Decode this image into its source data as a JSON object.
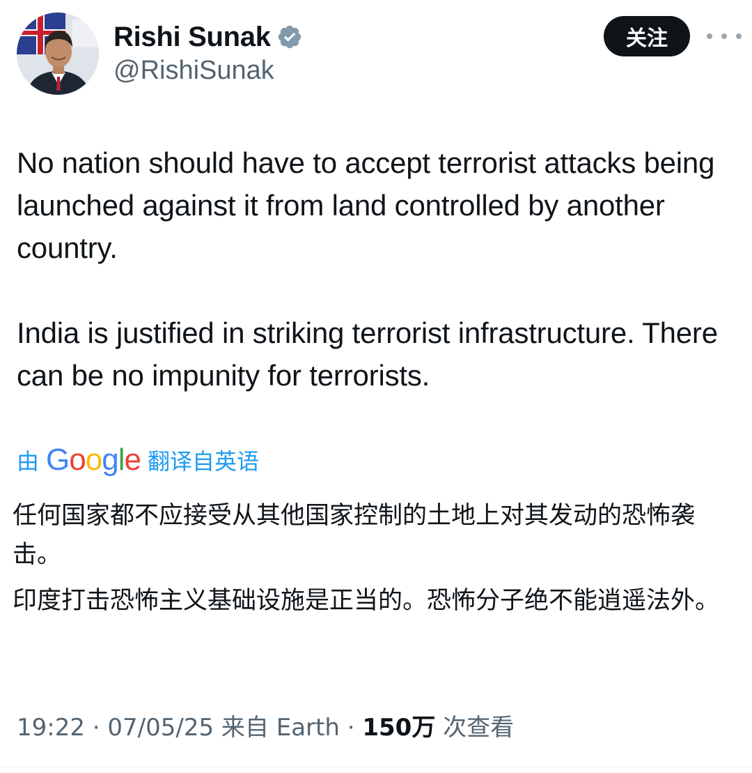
{
  "author": {
    "display_name": "Rishi Sunak",
    "handle": "@RishiSunak",
    "verified": true,
    "verified_badge_color": "#829aab"
  },
  "actions": {
    "follow_label": "关注",
    "more_icon": "more-horizontal-icon"
  },
  "tweet": {
    "paragraphs": [
      "No nation should have to accept terrorist attacks being launched against it from land controlled by another country.",
      "India is justified in striking terrorist infrastructure. There can be no impunity for terrorists."
    ]
  },
  "translation": {
    "prefix": "由",
    "provider": "Google",
    "suffix": "翻译自英语",
    "paragraphs": [
      "任何国家都不应接受从其他国家控制的土地上对其发动的恐怖袭击。",
      "印度打击恐怖主义基础设施是正当的。恐怖分子绝不能逍遥法外。"
    ]
  },
  "meta": {
    "time": "19:22",
    "sep1": " · ",
    "date": "07/05/25",
    "source": " 来自 Earth",
    "sep2": " · ",
    "views_count": "150万",
    "views_label": " 次查看"
  },
  "colors": {
    "text": "#0f1419",
    "secondary": "#536471",
    "link": "#1d9bf0",
    "button_bg": "#0f1419"
  }
}
